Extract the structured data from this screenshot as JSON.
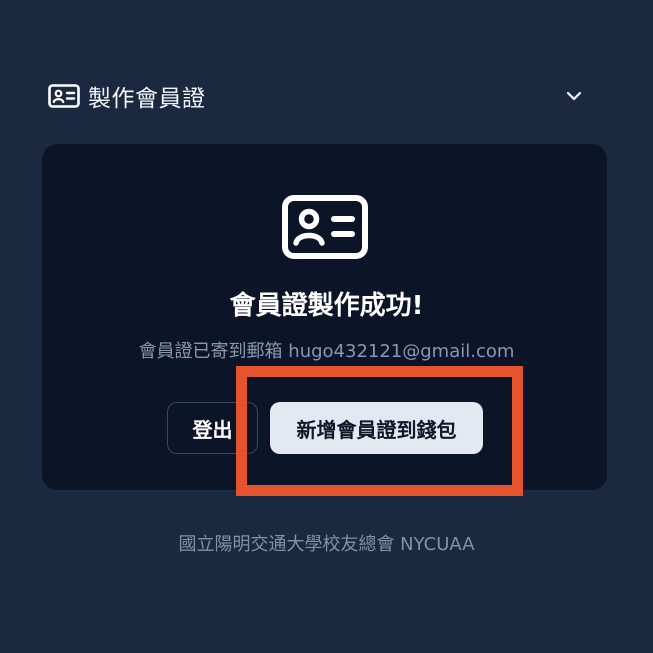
{
  "section": {
    "title": "製作會員證",
    "header_icon": "id-card-icon",
    "toggle_icon": "chevron-down-icon"
  },
  "card": {
    "icon": "id-card-icon",
    "title": "會員證製作成功!",
    "email_message": "會員證已寄到郵箱 hugo432121@gmail.com",
    "logout_label": "登出",
    "add_wallet_label": "新增會員證到錢包"
  },
  "footer": {
    "text": "國立陽明交通大學校友總會 NYCUAA"
  },
  "colors": {
    "background": "#1b2940",
    "card_background": "#0c1427",
    "primary_button": "#e3e8f1",
    "highlight": "#e4532c"
  }
}
